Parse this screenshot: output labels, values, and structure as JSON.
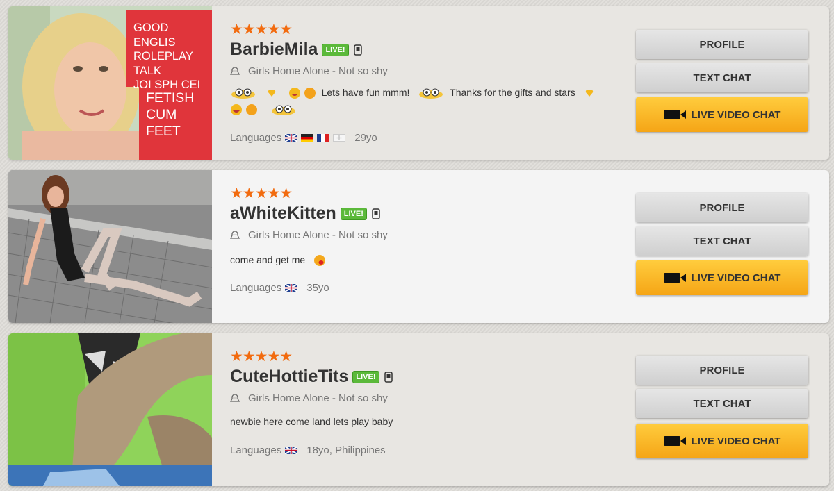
{
  "models": [
    {
      "stars": "★★★★★",
      "name": "BarbieMila",
      "live_label": "LIVE!",
      "category": "Girls Home Alone - Not so shy",
      "bio_parts": [
        "Lets have fun mmm!",
        "Thanks for the gifts and stars"
      ],
      "languages_label": "Languages",
      "age": "29yo",
      "thumb_text": [
        "GOOD ENGLIS",
        "ROLEPLAY",
        "TALK",
        "JOI SPH CEI",
        "FETISH",
        "CUM",
        "FEET"
      ],
      "flags": [
        "uk-flag",
        "de-flag",
        "fr-flag",
        "other-flag"
      ]
    },
    {
      "stars": "★★★★★",
      "name": "aWhiteKitten",
      "live_label": "LIVE!",
      "category": "Girls Home Alone - Not so shy",
      "bio": "come and get me",
      "languages_label": "Languages",
      "age": "35yo",
      "flags": [
        "uk-flag"
      ]
    },
    {
      "stars": "★★★★★",
      "name": "CuteHottieTits",
      "live_label": "LIVE!",
      "category": "Girls Home Alone - Not so shy",
      "bio": "newbie here come land lets play baby",
      "languages_label": "Languages",
      "age": "18yo, Philippines",
      "flags": [
        "uk-flag"
      ]
    }
  ],
  "buttons": {
    "profile": "PROFILE",
    "text_chat": "TEXT CHAT",
    "live_video": "LIVE VIDEO CHAT"
  },
  "colors": {
    "star": "#f26b0f",
    "live_badge": "#5bb93a",
    "gold_button": "#ffc12e"
  }
}
